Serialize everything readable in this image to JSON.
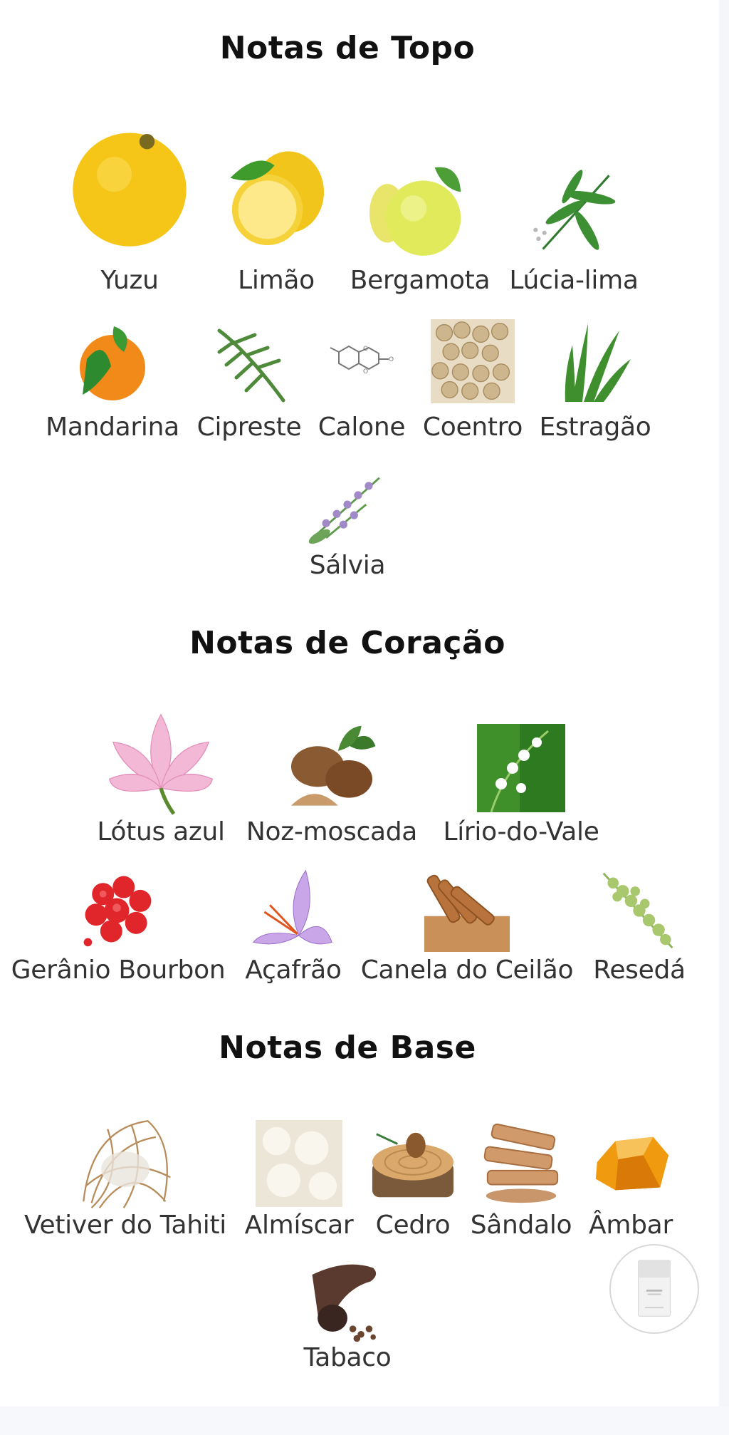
{
  "sections": {
    "top": {
      "title": "Notas de Topo",
      "notes": [
        {
          "label": "Yuzu",
          "icon": "yuzu-icon"
        },
        {
          "label": "Limão",
          "icon": "lemon-icon"
        },
        {
          "label": "Bergamota",
          "icon": "bergamot-icon"
        },
        {
          "label": "Lúcia-lima",
          "icon": "lemon-verbena-icon"
        },
        {
          "label": "Mandarina",
          "icon": "mandarin-icon"
        },
        {
          "label": "Cipreste",
          "icon": "cypress-icon"
        },
        {
          "label": "Calone",
          "icon": "molecule-icon"
        },
        {
          "label": "Coentro",
          "icon": "coriander-seeds-icon"
        },
        {
          "label": "Estragão",
          "icon": "tarragon-icon"
        },
        {
          "label": "Sálvia",
          "icon": "sage-icon"
        }
      ]
    },
    "heart": {
      "title": "Notas de Coração",
      "notes": [
        {
          "label": "Lótus azul",
          "icon": "lotus-icon"
        },
        {
          "label": "Noz-moscada",
          "icon": "nutmeg-icon"
        },
        {
          "label": "Lírio-do-Vale",
          "icon": "lily-of-the-valley-icon"
        },
        {
          "label": "Gerânio Bourbon",
          "icon": "geranium-icon"
        },
        {
          "label": "Açafrão",
          "icon": "saffron-icon"
        },
        {
          "label": "Canela do Ceilão",
          "icon": "cinnamon-icon"
        },
        {
          "label": "Resedá",
          "icon": "reseda-icon"
        }
      ]
    },
    "base": {
      "title": "Notas de Base",
      "notes": [
        {
          "label": "Vetiver do Tahiti",
          "icon": "vetiver-icon"
        },
        {
          "label": "Almíscar",
          "icon": "musk-icon"
        },
        {
          "label": "Cedro",
          "icon": "cedar-icon"
        },
        {
          "label": "Sândalo",
          "icon": "sandalwood-icon"
        },
        {
          "label": "Âmbar",
          "icon": "amber-icon"
        },
        {
          "label": "Tabaco",
          "icon": "tobacco-icon"
        }
      ]
    }
  },
  "colors": {
    "title": "#111111",
    "label": "#333333",
    "bottle_border": "#d9d9d9"
  }
}
